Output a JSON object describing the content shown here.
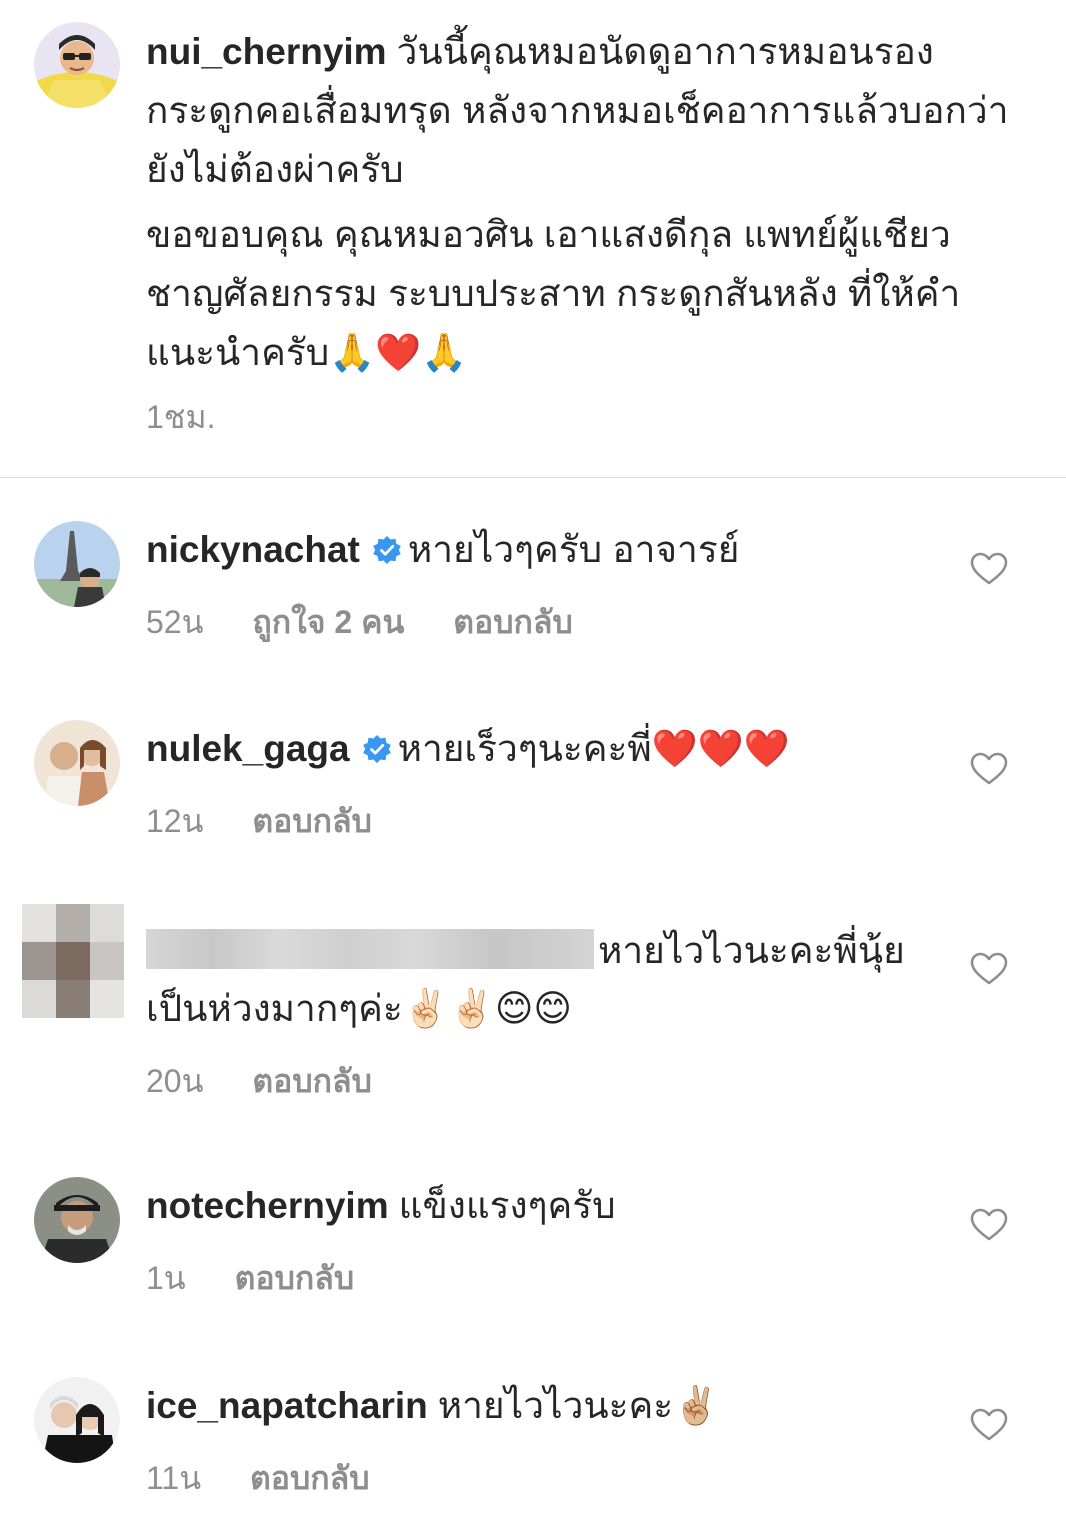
{
  "caption": {
    "username": "nui_chernyim",
    "text_line1": "วันนี้คุณหมอนัดดูอาการหมอนรองกระดูกคอเสื่อมทรุด หลังจากหมอเช็คอาการแล้วบอกว่ายังไม่ต้องผ่าครับ",
    "text_line2": "ขอขอบคุณ คุณหมอวศิน เอาแสงดีกุล แพทย์ผู้แชียวชาญศัลยกรรม ระบบประสาท กระดูกสันหลัง ที่ให้คำแนะนำครับ🙏❤️🙏",
    "time": "1ชม."
  },
  "comments": [
    {
      "username": "nickynachat",
      "verified": true,
      "text": "หายไวๆครับ อาจารย์",
      "time": "52น",
      "likes": "ถูกใจ 2 คน",
      "reply": "ตอบกลับ",
      "heart_icon": "heart-outline-icon"
    },
    {
      "username": "nulek_gaga",
      "verified": true,
      "text": "หายเร็วๆนะคะพี่❤️❤️❤️",
      "time": "12น",
      "reply": "ตอบกลับ",
      "heart_icon": "heart-outline-icon"
    },
    {
      "username": "",
      "verified": false,
      "text": "หายไวไวนะคะพี่นุ้ย เป็นห่วงมากๆค่ะ✌🏻✌🏻😊😊",
      "time": "20น",
      "reply": "ตอบกลับ",
      "heart_icon": "heart-outline-icon"
    },
    {
      "username": "notechernyim",
      "verified": false,
      "text": "แข็งแรงๆครับ",
      "time": "1น",
      "reply": "ตอบกลับ",
      "heart_icon": "heart-outline-icon"
    },
    {
      "username": "ice_napatcharin",
      "verified": false,
      "text": "หายไวไวนะคะ✌🏼",
      "time": "11น",
      "reply": "ตอบกลับ",
      "heart_icon": "heart-outline-icon"
    }
  ],
  "colors": {
    "text": "#262626",
    "secondary": "#8e8e8e",
    "verified": "#3897f0",
    "divider": "#dbdbdb"
  }
}
